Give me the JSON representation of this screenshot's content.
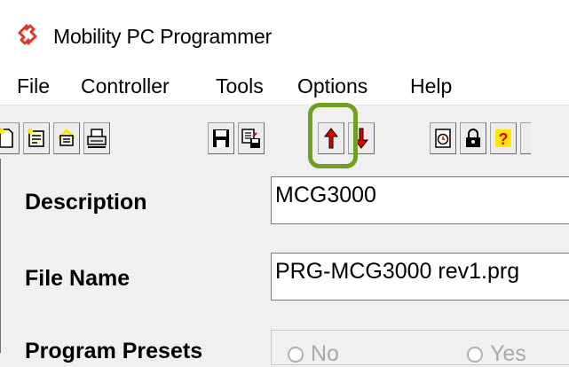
{
  "window": {
    "title": "Mobility PC Programmer"
  },
  "menu": {
    "items": [
      "File",
      "Controller",
      "Tools",
      "Options",
      "Help"
    ]
  },
  "toolbar": {
    "buttons": [
      "new-icon",
      "open-icon",
      "wizard-icon",
      "print-icon",
      "save-icon",
      "save-as-icon",
      "upload-icon",
      "download-icon",
      "schedule-icon",
      "lock-icon",
      "help-icon"
    ],
    "highlighted": "upload-icon",
    "highlight_color": "#6fa023"
  },
  "form": {
    "description_label": "Description",
    "description_value": "MCG3000",
    "filename_label": "File Name",
    "filename_value": "PRG-MCG3000 rev1.prg",
    "presets_label": "Program Presets",
    "presets_options": [
      "No",
      "Yes"
    ]
  }
}
